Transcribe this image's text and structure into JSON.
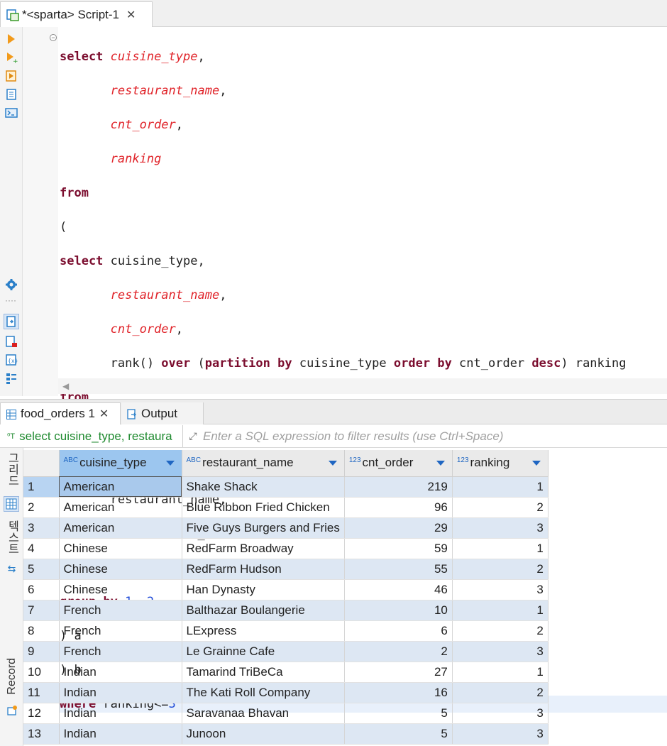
{
  "editor": {
    "tab_title": "*<sparta> Script-1"
  },
  "results": {
    "tabs": [
      {
        "label": "food_orders 1"
      },
      {
        "label": "Output"
      }
    ],
    "query_label": "select cuisine_type, restaura",
    "filter_placeholder": "Enter a SQL expression to filter results (use Ctrl+Space)",
    "side": {
      "grid_label": "그리드",
      "text_label": "텍스트",
      "record_label": "Record"
    },
    "columns": [
      {
        "type": "ABC",
        "name": "cuisine_type"
      },
      {
        "type": "ABC",
        "name": "restaurant_name"
      },
      {
        "type": "123",
        "name": "cnt_order"
      },
      {
        "type": "123",
        "name": "ranking"
      }
    ],
    "rows": [
      {
        "n": "1",
        "cuisine": "American",
        "restaurant": "Shake Shack",
        "cnt": "219",
        "rank": "1"
      },
      {
        "n": "2",
        "cuisine": "American",
        "restaurant": "Blue Ribbon Fried Chicken",
        "cnt": "96",
        "rank": "2"
      },
      {
        "n": "3",
        "cuisine": "American",
        "restaurant": "Five Guys Burgers and Fries",
        "cnt": "29",
        "rank": "3"
      },
      {
        "n": "4",
        "cuisine": "Chinese",
        "restaurant": "RedFarm Broadway",
        "cnt": "59",
        "rank": "1"
      },
      {
        "n": "5",
        "cuisine": "Chinese",
        "restaurant": "RedFarm Hudson",
        "cnt": "55",
        "rank": "2"
      },
      {
        "n": "6",
        "cuisine": "Chinese",
        "restaurant": "Han Dynasty",
        "cnt": "46",
        "rank": "3"
      },
      {
        "n": "7",
        "cuisine": "French",
        "restaurant": "Balthazar Boulangerie",
        "cnt": "10",
        "rank": "1"
      },
      {
        "n": "8",
        "cuisine": "French",
        "restaurant": "LExpress",
        "cnt": "6",
        "rank": "2"
      },
      {
        "n": "9",
        "cuisine": "French",
        "restaurant": "Le Grainne Cafe",
        "cnt": "2",
        "rank": "3"
      },
      {
        "n": "10",
        "cuisine": "Indian",
        "restaurant": "Tamarind TriBeCa",
        "cnt": "27",
        "rank": "1"
      },
      {
        "n": "11",
        "cuisine": "Indian",
        "restaurant": "The Kati Roll Company",
        "cnt": "16",
        "rank": "2"
      },
      {
        "n": "12",
        "cuisine": "Indian",
        "restaurant": "Saravanaa Bhavan",
        "cnt": "5",
        "rank": "3"
      },
      {
        "n": "13",
        "cuisine": "Indian",
        "restaurant": "Junoon",
        "cnt": "5",
        "rank": "3"
      }
    ]
  }
}
